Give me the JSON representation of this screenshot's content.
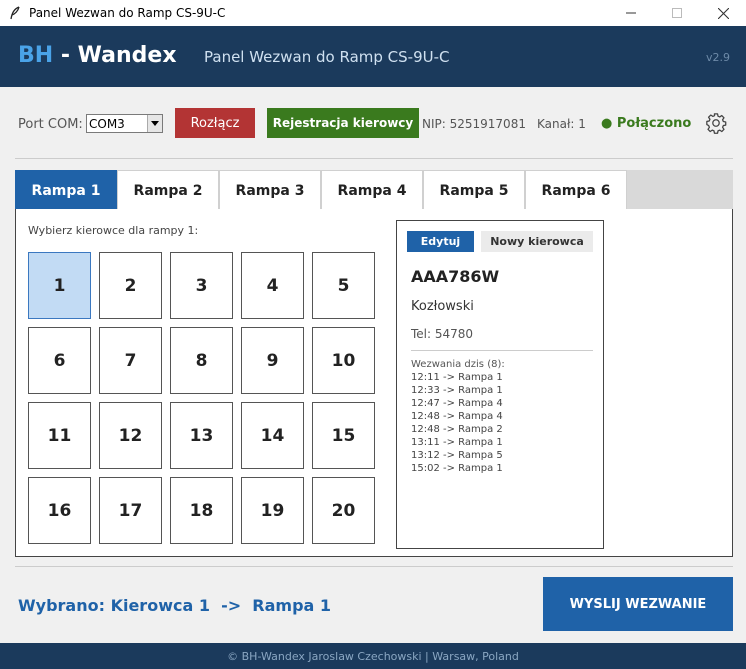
{
  "window": {
    "title": "Panel Wezwan do Ramp CS-9U-C",
    "app_icon": "feather-icon",
    "controls": [
      "minimize-icon",
      "maximize-icon",
      "close-icon"
    ]
  },
  "header": {
    "brand_prefix": "BH",
    "brand_dash": "-",
    "brand_name": "Wandex",
    "subtitle": "Panel Wezwan do Ramp CS-9U-C",
    "version": "v2.9"
  },
  "toolbar": {
    "port_label": "Port COM:",
    "port_value": "COM3",
    "disconnect_label": "Rozłącz",
    "register_label": "Rejestracja kierowcy",
    "nip": "NIP: 5251917081",
    "channel": "Kanał: 1",
    "status": "● Połączono",
    "settings_icon": "gear-icon"
  },
  "tabs": [
    "Rampa 1",
    "Rampa 2",
    "Rampa 3",
    "Rampa 4",
    "Rampa 5",
    "Rampa 6"
  ],
  "active_tab": 0,
  "main": {
    "choose_label": "Wybierz kierowce dla rampy 1:",
    "drivers": [
      "1",
      "2",
      "3",
      "4",
      "5",
      "6",
      "7",
      "8",
      "9",
      "10",
      "11",
      "12",
      "13",
      "14",
      "15",
      "16",
      "17",
      "18",
      "19",
      "20"
    ],
    "selected_driver": "1"
  },
  "card": {
    "tab_edit": "Edytuj",
    "tab_new": "Nowy kierowca",
    "plate": "AAA786W",
    "name": "Kozłowski",
    "phone": "Tel: 54780",
    "calls_title": "Wezwania dzis (8):",
    "calls": [
      "12:11 -> Rampa 1",
      "12:33 -> Rampa 1",
      "12:47 -> Rampa 4",
      "12:48 -> Rampa 4",
      "12:48 -> Rampa 2",
      "13:11 -> Rampa 1",
      "13:12 -> Rampa 5",
      "15:02 -> Rampa 1"
    ]
  },
  "footer_area": {
    "selection": "Wybrano: Kierowca 1  ->  Rampa 1",
    "call_button": "WYSLIJ WEZWANIE"
  },
  "footer": {
    "text": "© BH-Wandex Jaroslaw Czechowski  |  Warsaw, Poland"
  },
  "colors": {
    "header_bg": "#1b3a5c",
    "accent": "#1f62a8",
    "brand_accent": "#4aa3e8",
    "danger": "#b33434",
    "success": "#3a7a1e",
    "selected_cell": "#c2dbf4"
  }
}
